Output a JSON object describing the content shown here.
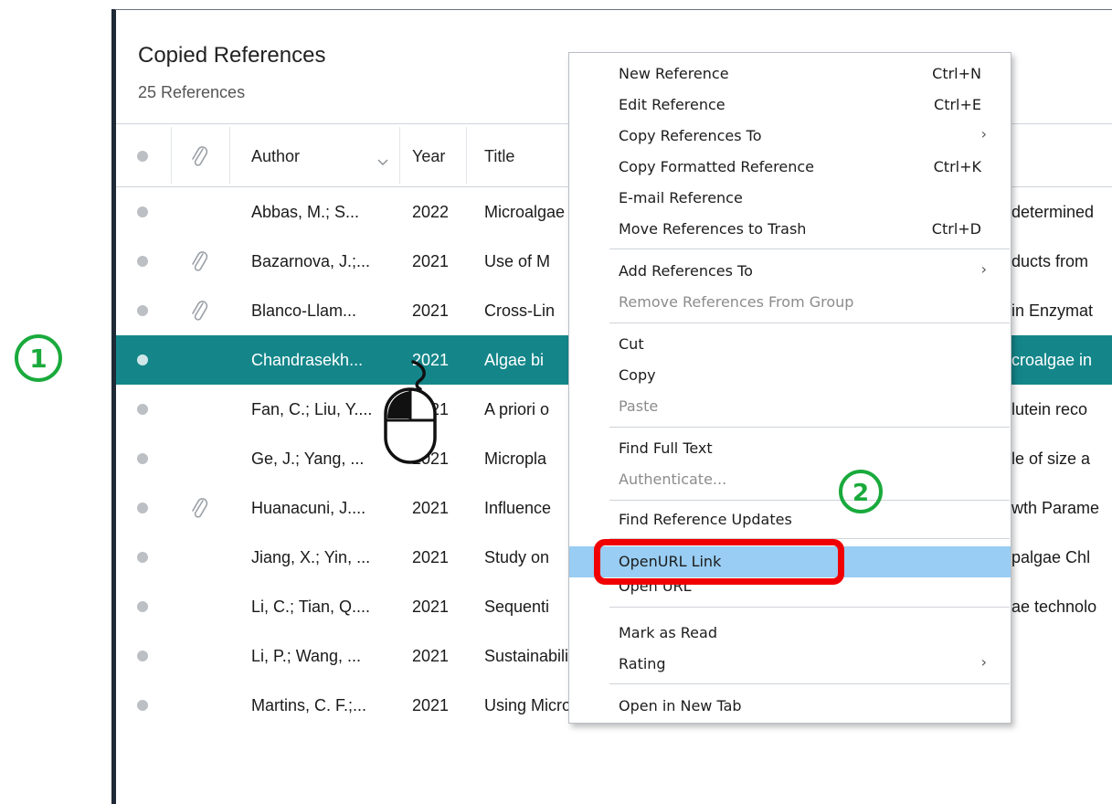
{
  "header": {
    "title": "Copied References",
    "count": "25 References"
  },
  "columns": {
    "author": "Author",
    "year": "Year",
    "title": "Title"
  },
  "rows": [
    {
      "author": "Abbas, M.; S...",
      "year": "2022",
      "title": "Microalgae",
      "title_tail": "determined",
      "attachment": false
    },
    {
      "author": "Bazarnova, J.;...",
      "year": "2021",
      "title": "Use of M",
      "title_tail": "ducts from",
      "attachment": true
    },
    {
      "author": "Blanco-Llam...",
      "year": "2021",
      "title": "Cross-Lin",
      "title_tail": "in Enzymat",
      "attachment": true
    },
    {
      "author": "Chandrasekh...",
      "year": "2021",
      "title": "Algae bi",
      "title_tail": "croalgae in",
      "attachment": false
    },
    {
      "author": "Fan, C.; Liu, Y....",
      "year": "2021",
      "title": "A priori o",
      "title_tail": "lutein reco",
      "attachment": false
    },
    {
      "author": "Ge, J.; Yang, ...",
      "year": "2021",
      "title": "Micropla",
      "title_tail": "le of size a",
      "attachment": false
    },
    {
      "author": "Huanacuni, J....",
      "year": "2021",
      "title": "Influence",
      "title_tail": "wth Parame",
      "attachment": true
    },
    {
      "author": "Jiang, X.; Yin, ...",
      "year": "2021",
      "title": "Study on",
      "title_tail": "palgae Chl",
      "attachment": false
    },
    {
      "author": "Li, C.; Tian, Q....",
      "year": "2021",
      "title": "Sequenti",
      "title_tail": "ae technolo",
      "attachment": false
    },
    {
      "author": "Li, P.; Wang, ...",
      "year": "2021",
      "title": "Sustainability evaluation of microalgae biodiesel production proce",
      "title_tail": "",
      "attachment": false
    },
    {
      "author": "Martins, C. F.;...",
      "year": "2021",
      "title": "Using Microalgae as a Sustainable Feed Resource to Enhance Qual",
      "title_tail": "",
      "attachment": false
    }
  ],
  "context_menu": {
    "new_reference": {
      "label": "New Reference",
      "shortcut": "Ctrl+N"
    },
    "edit_reference": {
      "label": "Edit Reference",
      "shortcut": "Ctrl+E"
    },
    "copy_references_to": {
      "label": "Copy References To"
    },
    "copy_formatted_reference": {
      "label": "Copy Formatted Reference",
      "shortcut": "Ctrl+K"
    },
    "email_reference": {
      "label": "E-mail Reference"
    },
    "move_to_trash": {
      "label": "Move References to Trash",
      "shortcut": "Ctrl+D"
    },
    "add_references_to": {
      "label": "Add References To"
    },
    "remove_from_group": {
      "label": "Remove References From Group"
    },
    "cut": {
      "label": "Cut"
    },
    "copy": {
      "label": "Copy"
    },
    "paste": {
      "label": "Paste"
    },
    "find_full_text": {
      "label": "Find Full Text"
    },
    "authenticate": {
      "label": "Authenticate..."
    },
    "find_reference_updates": {
      "label": "Find Reference Updates"
    },
    "openurl_link": {
      "label": "OpenURL Link"
    },
    "open_url": {
      "label": "Open URL"
    },
    "mark_as_read": {
      "label": "Mark as Read"
    },
    "rating": {
      "label": "Rating"
    },
    "open_in_new_tab": {
      "label": "Open in New Tab"
    },
    "submenu_arrow": "›"
  },
  "annotations": {
    "step1": "1",
    "step2": "2",
    "step_color": "#1aaa3c",
    "highlight_color": "#f00000"
  },
  "colors": {
    "selected_row": "#14868a",
    "menu_highlight": "#99cdf3"
  }
}
